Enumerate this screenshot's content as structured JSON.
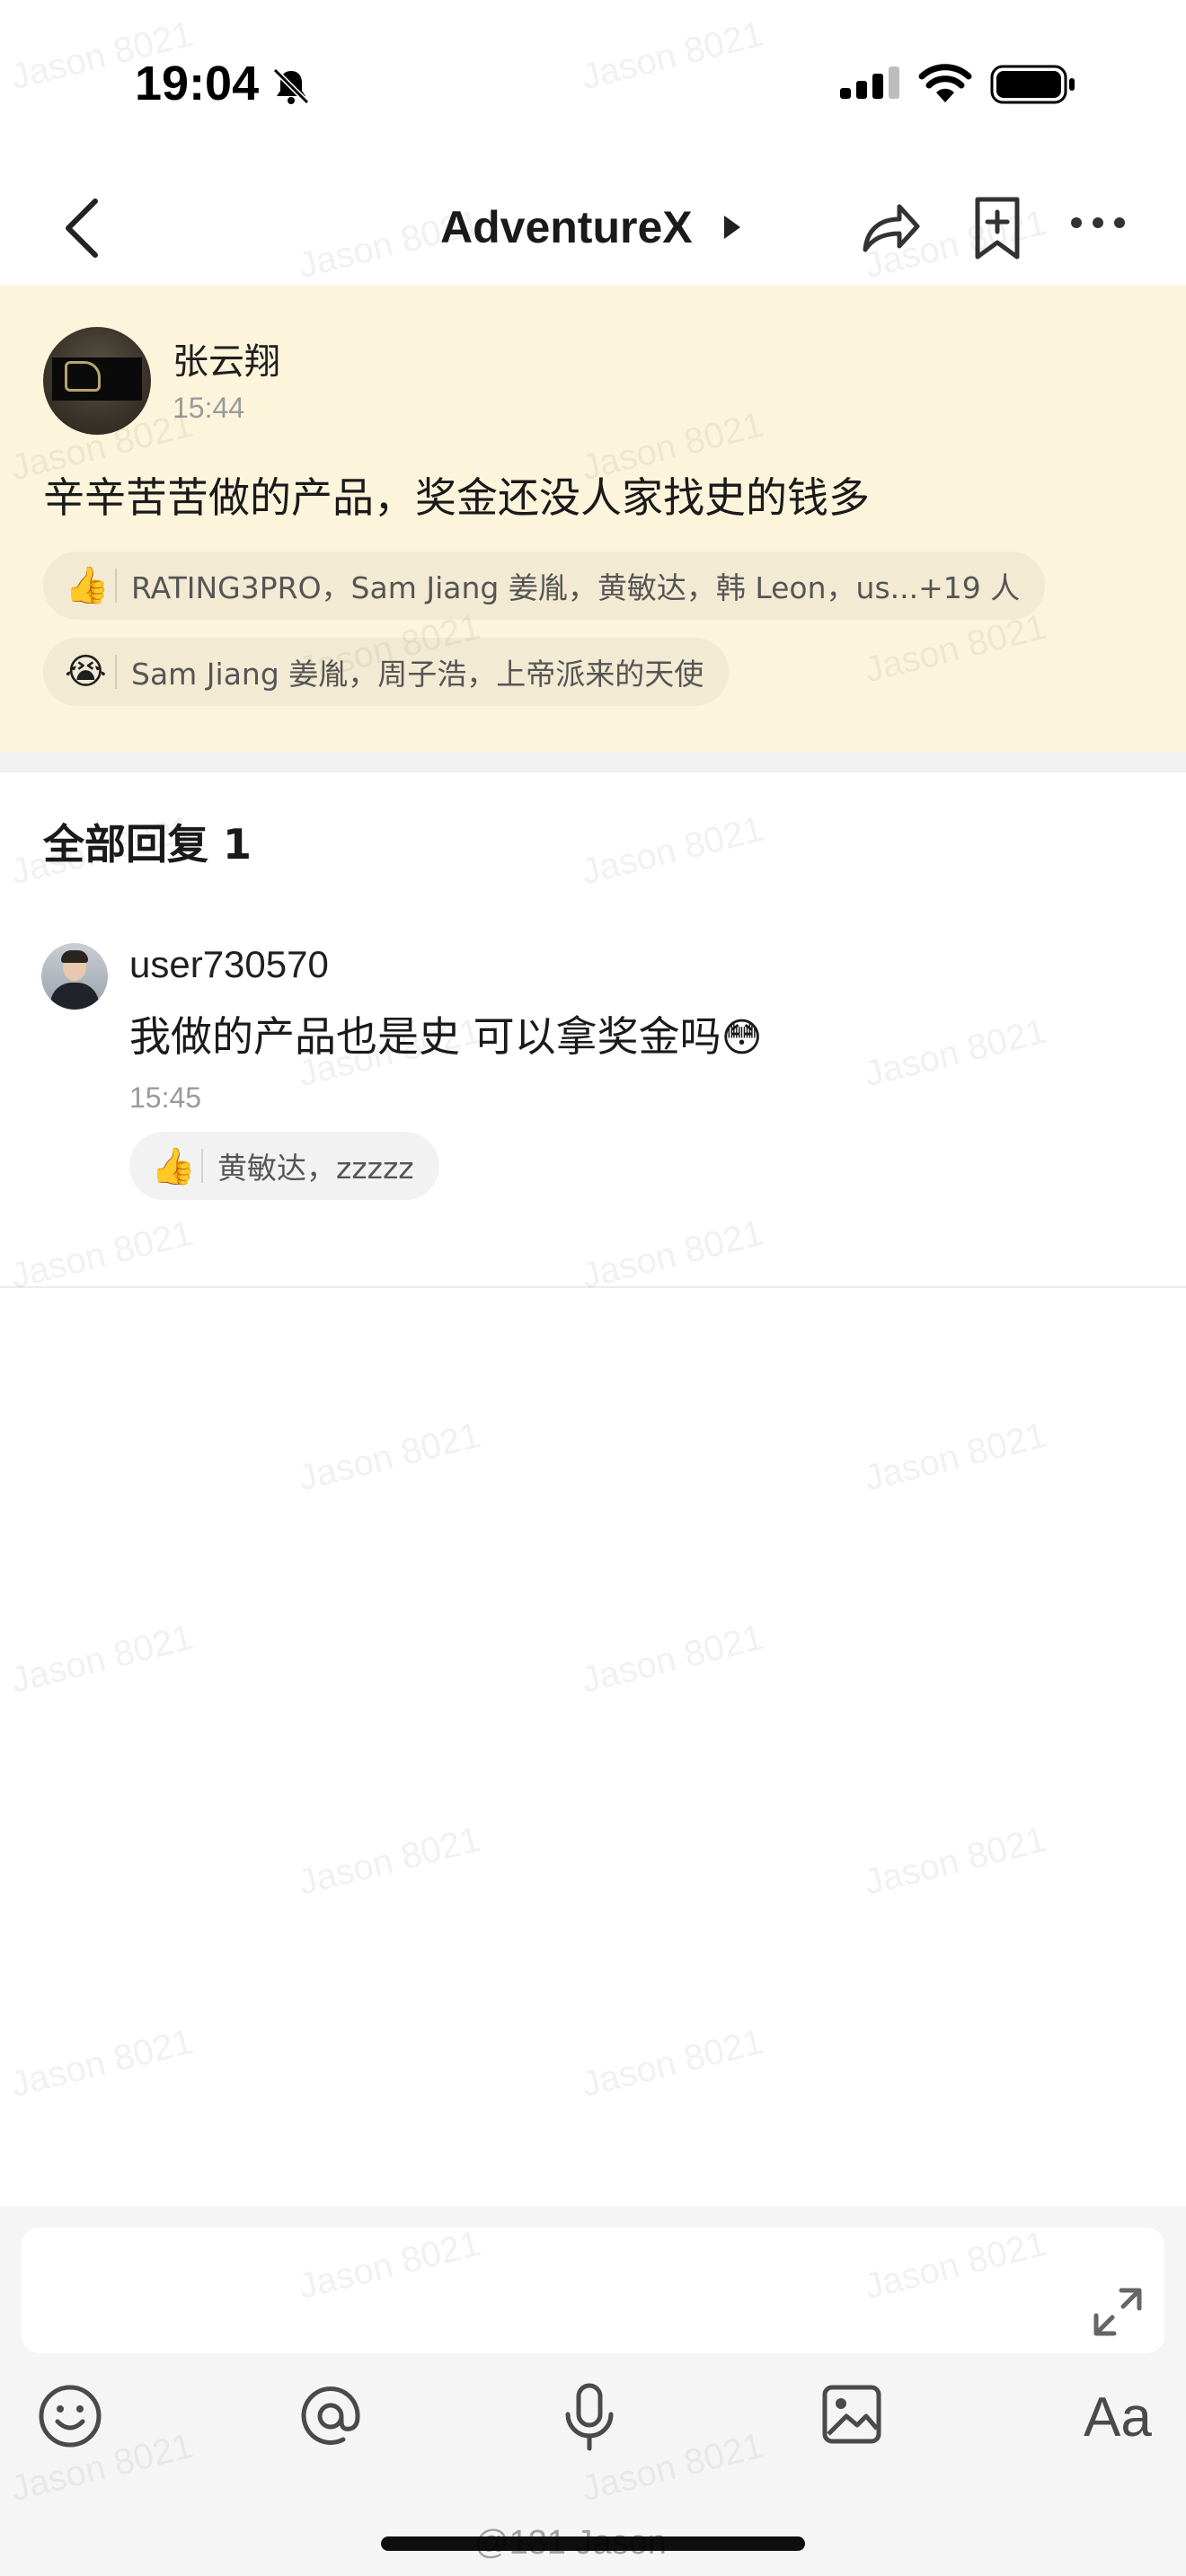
{
  "status_bar": {
    "time": "19:04"
  },
  "nav": {
    "title": "AdventureX"
  },
  "post": {
    "author": "张云翔",
    "time": "15:44",
    "text": "辛辛苦苦做的产品，奖金还没人家找史的钱多",
    "reactions": [
      {
        "emoji": "👍",
        "icon": "thumbs-up",
        "names": "RATING3PRO，Sam Jiang 姜胤，黄敏达，韩 Leon，us...+19 人"
      },
      {
        "emoji": "😭",
        "icon": "crying-face",
        "names": "Sam Jiang 姜胤，周子浩，上帝派来的天使"
      }
    ]
  },
  "replies": {
    "heading": "全部回复 1",
    "items": [
      {
        "user": "user730570",
        "text": "我做的产品也是史 可以拿奖金吗",
        "emoji": "😳",
        "time": "15:45",
        "reaction": {
          "emoji": "👍",
          "icon": "thumbs-up",
          "names": "黄敏达，zzzzz"
        }
      }
    ]
  },
  "watermark": "Jason 8021",
  "footer_credit": "@131 Jason",
  "colors": {
    "post_highlight": "#fdf4dc",
    "composer_bg": "#f5f5f5",
    "icon": "#4a4a4a"
  }
}
